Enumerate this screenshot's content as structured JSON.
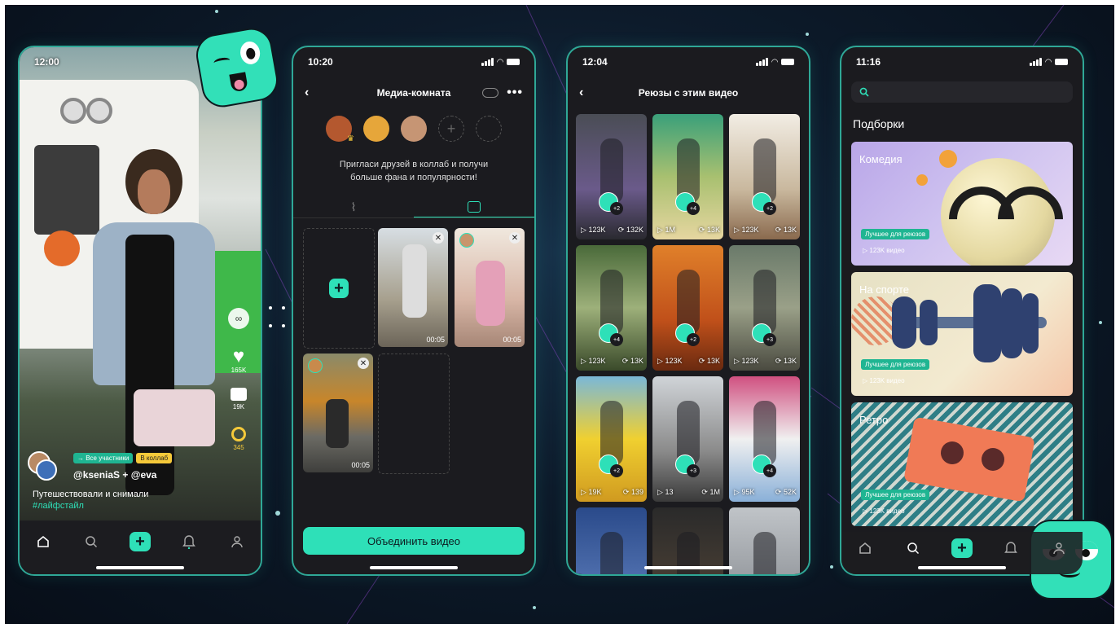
{
  "phone1": {
    "time": "12:00",
    "side_counts": {
      "likes": "165K",
      "comments": "19K",
      "reposts": "345"
    },
    "chips": {
      "all": "→ Все участники",
      "collab": "В коллаб"
    },
    "authors": "@kseniaS + @eva",
    "caption": "Путешествовали и снимали",
    "hashtag": "#лайфстайл"
  },
  "phone2": {
    "time": "10:20",
    "title": "Медиа-комната",
    "invite_text": "Пригласи друзей в коллаб и получи больше фана и популярности!",
    "clips": [
      {
        "duration": "00:05"
      },
      {
        "duration": "00:05"
      },
      {
        "duration": "00:05"
      }
    ],
    "merge_button": "Объединить видео"
  },
  "phone3": {
    "time": "12:04",
    "title": "Реюзы с этим видео",
    "tiles": [
      {
        "views": "123K",
        "reuses": "132K",
        "more": "+2"
      },
      {
        "views": "1M",
        "reuses": "13K",
        "more": "+4"
      },
      {
        "views": "123K",
        "reuses": "13K",
        "more": "+2"
      },
      {
        "views": "123K",
        "reuses": "13K",
        "more": "+4"
      },
      {
        "views": "123K",
        "reuses": "13K",
        "more": "+2"
      },
      {
        "views": "123K",
        "reuses": "13K",
        "more": "+3"
      },
      {
        "views": "19K",
        "reuses": "139",
        "more": "+2"
      },
      {
        "views": "13",
        "reuses": "1M",
        "more": "+3"
      },
      {
        "views": "95K",
        "reuses": "52K",
        "more": "+4"
      }
    ]
  },
  "phone4": {
    "time": "11:16",
    "section_title": "Подборки",
    "collections": [
      {
        "title": "Комедия",
        "badge": "Лучшее для реюзов",
        "count": "123K видео"
      },
      {
        "title": "На спорте",
        "badge": "Лучшее для реюзов",
        "count": "123K видео"
      },
      {
        "title": "Ретро",
        "badge": "Лучшее для реюзов",
        "count": "123K видео"
      }
    ]
  },
  "colors": {
    "accent": "#2ee0b8",
    "phone_bg": "#1b1b1f",
    "stage_bg": "#0d1b2b"
  }
}
